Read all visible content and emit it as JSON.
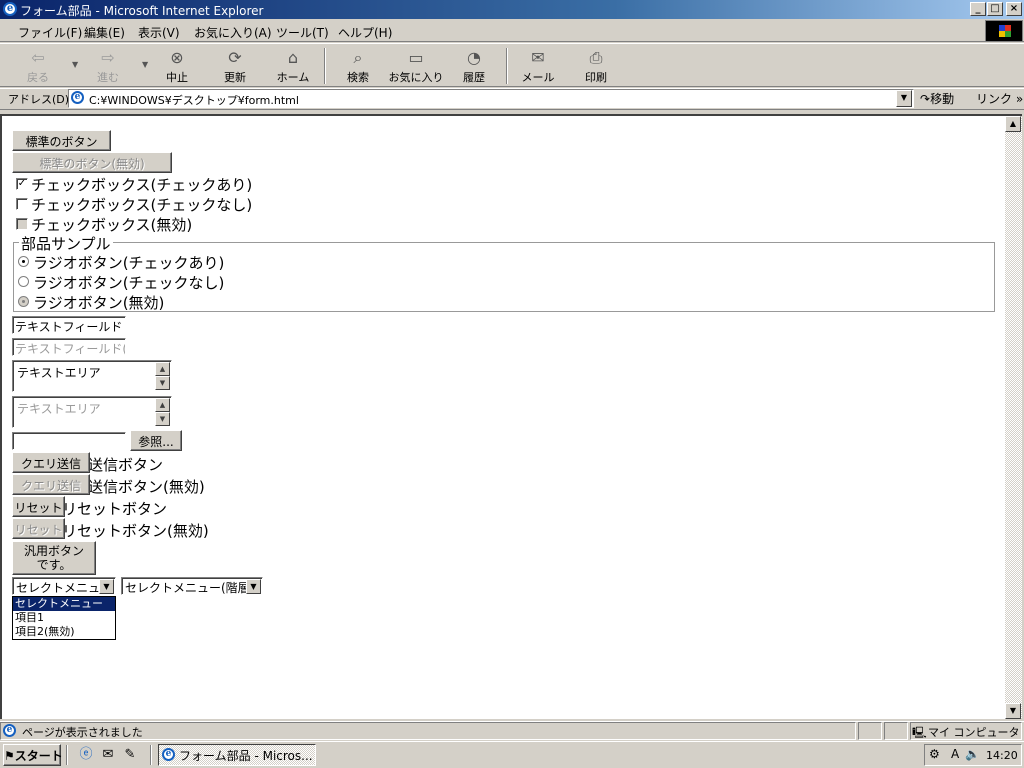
{
  "window": {
    "title": "フォーム部品 - Microsoft Internet Explorer",
    "controls": [
      "_",
      "□",
      "×"
    ]
  },
  "menu": [
    "ファイル(F)",
    "編集(E)",
    "表示(V)",
    "お気に入り(A)",
    "ツール(T)",
    "ヘルプ(H)"
  ],
  "toolbar": {
    "back": "戻る",
    "forward": "進む",
    "stop": "中止",
    "refresh": "更新",
    "home": "ホーム",
    "search": "検索",
    "favorites": "お気に入り",
    "history": "履歴",
    "mail": "メール",
    "print": "印刷"
  },
  "address": {
    "label": "アドレス(D)",
    "url": "C:¥WINDOWS¥デスクトップ¥form.html",
    "go": "移動",
    "links": "リンク »"
  },
  "form": {
    "button": "標準のボタン",
    "button_disabled": "標準のボタン(無効)",
    "checkboxes": [
      {
        "label": "チェックボックス(チェックあり)",
        "checked": true,
        "disabled": false
      },
      {
        "label": "チェックボックス(チェックなし)",
        "checked": false,
        "disabled": false
      },
      {
        "label": "チェックボックス(無効)",
        "checked": false,
        "disabled": true
      }
    ],
    "fieldset_legend": "部品サンプル",
    "radios": [
      {
        "label": "ラジオボタン(チェックあり)",
        "checked": true,
        "disabled": false
      },
      {
        "label": "ラジオボタン(チェックなし)",
        "checked": false,
        "disabled": false
      },
      {
        "label": "ラジオボタン(無効)",
        "checked": true,
        "disabled": true
      }
    ],
    "text_field": "テキストフィールド",
    "text_field_disabled": "テキストフィールド(無効)",
    "textarea": "テキストエリア",
    "textarea_disabled": "テキストエリア",
    "file_value": "",
    "browse": "参照...",
    "submit": "クエリ送信",
    "submit_label": "送信ボタン",
    "submit_disabled": "クエリ送信",
    "submit_disabled_label": "送信ボタン(無効)",
    "reset": "リセット",
    "reset_label": "リセットボタン",
    "reset_disabled": "リセット",
    "reset_disabled_label": "リセットボタン(無効)",
    "generic_button_line1": "汎用ボタン",
    "generic_button_line2": "です。",
    "select1": "セレクトメニュー",
    "select2": "セレクトメニュー(階層)",
    "options": [
      "セレクトメニュー",
      "項目1",
      "項目2(無効)"
    ]
  },
  "status": {
    "text": "ページが表示されました",
    "zone": "マイ コンピュータ"
  },
  "taskbar": {
    "start": "スタート",
    "task": "フォーム部品 - Micros...",
    "clock": "14:20"
  },
  "colors": {
    "titlebar_start": "#0a246a",
    "titlebar_end": "#a6caf0",
    "face": "#d4d0c8",
    "selection": "#0a246a"
  }
}
